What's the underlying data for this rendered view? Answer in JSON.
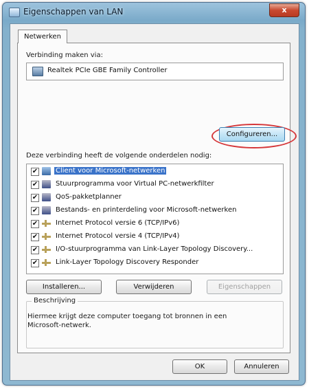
{
  "window": {
    "title": "Eigenschappen van LAN",
    "close_label": "x"
  },
  "tabs": [
    {
      "label": "Netwerken",
      "active": true
    }
  ],
  "connect_using": {
    "label": "Verbinding maken via:",
    "adapter_name": "Realtek PCIe GBE Family Controller",
    "adapter_icon": "network-adapter-icon",
    "configure_button": "Configureren..."
  },
  "components": {
    "label": "Deze verbinding heeft de volgende onderdelen nodig:",
    "items": [
      {
        "label": "Client voor Microsoft-netwerken",
        "checked": true,
        "icon": "client-icon",
        "selected": true
      },
      {
        "label": "Stuurprogramma voor Virtual PC-netwerkfilter",
        "checked": true,
        "icon": "service-icon",
        "selected": false
      },
      {
        "label": "QoS-pakketplanner",
        "checked": true,
        "icon": "service-icon",
        "selected": false
      },
      {
        "label": "Bestands- en printerdeling voor Microsoft-netwerken",
        "checked": true,
        "icon": "service-icon",
        "selected": false
      },
      {
        "label": "Internet Protocol versie 6 (TCP/IPv6)",
        "checked": true,
        "icon": "protocol-icon",
        "selected": false
      },
      {
        "label": "Internet Protocol versie 4 (TCP/IPv4)",
        "checked": true,
        "icon": "protocol-icon",
        "selected": false
      },
      {
        "label": "I/O-stuurprogramma van Link-Layer Topology Discovery...",
        "checked": true,
        "icon": "protocol-icon",
        "selected": false
      },
      {
        "label": "Link-Layer Topology Discovery Responder",
        "checked": true,
        "icon": "protocol-icon",
        "selected": false
      }
    ]
  },
  "actions": {
    "install": "Installeren...",
    "uninstall": "Verwijderen",
    "properties": "Eigenschappen"
  },
  "description": {
    "label": "Beschrijving",
    "text": "Hiermee krijgt deze computer toegang tot bronnen in een Microsoft-netwerk."
  },
  "footer": {
    "ok": "OK",
    "cancel": "Annuleren"
  },
  "colors": {
    "titlebar": "#7aaac9",
    "close_button": "#c8492f",
    "selection": "#3a73c9",
    "highlight_ring": "#d5373a"
  }
}
